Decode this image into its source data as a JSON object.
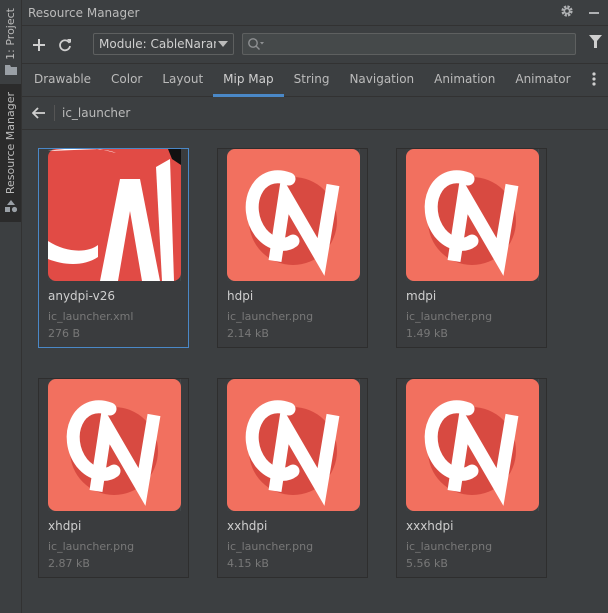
{
  "sidebar": {
    "project_label": "1: Project",
    "resource_manager_label": "Resource Manager"
  },
  "window": {
    "title": "Resource Manager"
  },
  "toolbar": {
    "module_label": "Module: CableNaranja",
    "search_placeholder": ""
  },
  "tabs": [
    {
      "label": "Drawable"
    },
    {
      "label": "Color"
    },
    {
      "label": "Layout"
    },
    {
      "label": "Mip Map",
      "active": true
    },
    {
      "label": "String"
    },
    {
      "label": "Navigation"
    },
    {
      "label": "Animation"
    },
    {
      "label": "Animator"
    }
  ],
  "breadcrumb": {
    "name": "ic_launcher"
  },
  "resources": [
    {
      "density": "anydpi-v26",
      "file": "ic_launcher.xml",
      "size": "276 B"
    },
    {
      "density": "hdpi",
      "file": "ic_launcher.png",
      "size": "2.14 kB"
    },
    {
      "density": "mdpi",
      "file": "ic_launcher.png",
      "size": "1.49 kB"
    },
    {
      "density": "xhdpi",
      "file": "ic_launcher.png",
      "size": "2.87 kB"
    },
    {
      "density": "xxhdpi",
      "file": "ic_launcher.png",
      "size": "4.15 kB"
    },
    {
      "density": "xxxhdpi",
      "file": "ic_launcher.png",
      "size": "5.56 kB"
    }
  ],
  "colors": {
    "accent": "#4a88c7",
    "icon_bg": "#f2705f",
    "icon_circle": "#d84a41",
    "adaptive_bg": "#e14b45"
  }
}
